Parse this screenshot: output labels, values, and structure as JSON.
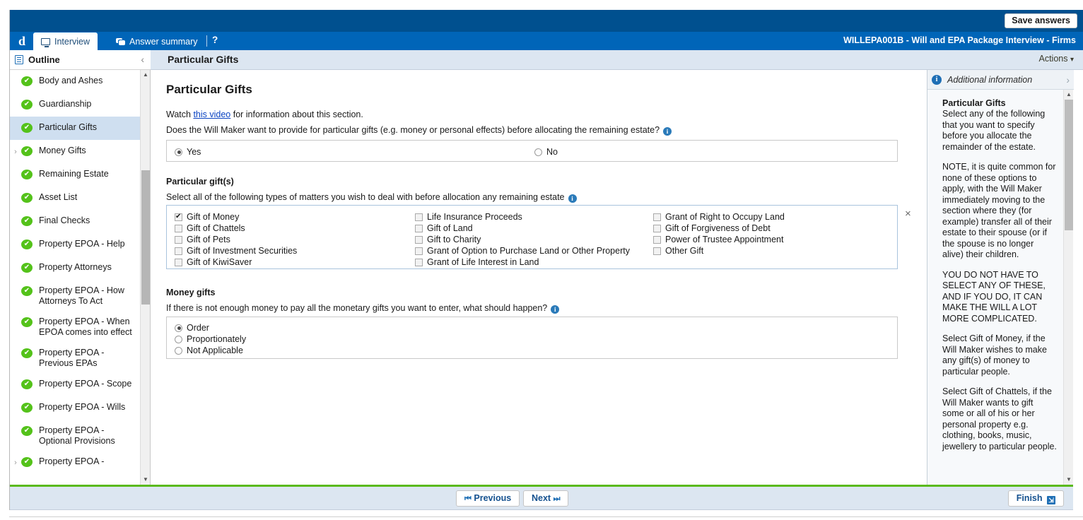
{
  "window": {
    "save_answers_label": "Save answers",
    "document_title": "WILLEPA001B - Will and EPA Package Interview - Firms",
    "logo_text": "d"
  },
  "tabs": [
    {
      "label": "Interview",
      "icon": "monitor-icon",
      "active": true
    },
    {
      "label": "Answer summary",
      "icon": "chat-icon",
      "active": false
    }
  ],
  "help_label": "?",
  "outline": {
    "header_label": "Outline",
    "collapse_icon": "chevron-left-icon",
    "items": [
      {
        "label": "Body and Ashes",
        "status": "complete",
        "expandable": false,
        "selected": false
      },
      {
        "label": "Guardianship",
        "status": "complete",
        "expandable": false,
        "selected": false
      },
      {
        "label": "Particular Gifts",
        "status": "complete",
        "expandable": false,
        "selected": true
      },
      {
        "label": "Money Gifts",
        "status": "complete",
        "expandable": true,
        "selected": false
      },
      {
        "label": "Remaining Estate",
        "status": "complete",
        "expandable": false,
        "selected": false
      },
      {
        "label": "Asset List",
        "status": "complete",
        "expandable": false,
        "selected": false
      },
      {
        "label": "Final Checks",
        "status": "complete",
        "expandable": false,
        "selected": false
      },
      {
        "label": "Property EPOA - Help",
        "status": "complete",
        "expandable": false,
        "selected": false
      },
      {
        "label": "Property Attorneys",
        "status": "complete",
        "expandable": false,
        "selected": false
      },
      {
        "label": "Property EPOA - How Attorneys To Act",
        "status": "complete",
        "expandable": false,
        "selected": false
      },
      {
        "label": "Property EPOA - When EPOA comes into effect",
        "status": "complete",
        "expandable": false,
        "selected": false
      },
      {
        "label": "Property EPOA - Previous EPAs",
        "status": "complete",
        "expandable": false,
        "selected": false
      },
      {
        "label": "Property EPOA - Scope",
        "status": "complete",
        "expandable": false,
        "selected": false
      },
      {
        "label": "Property EPOA - Wills",
        "status": "complete",
        "expandable": false,
        "selected": false
      },
      {
        "label": "Property EPOA - Optional Provisions",
        "status": "complete",
        "expandable": false,
        "selected": false
      },
      {
        "label": "Property EPOA -",
        "status": "complete",
        "expandable": true,
        "selected": false
      }
    ]
  },
  "page_header": {
    "title": "Particular Gifts",
    "actions_label": "Actions",
    "actions_caret": "▾"
  },
  "main": {
    "title": "Particular Gifts",
    "watch_prefix": "Watch ",
    "watch_link": "this video",
    "watch_suffix": " for information about this section.",
    "question_1": "Does the Will Maker want to provide for particular gifts (e.g. money or personal effects) before allocating the remaining estate?",
    "yes_no": [
      {
        "label": "Yes",
        "selected": true
      },
      {
        "label": "No",
        "selected": false
      }
    ],
    "gifts_section_label": "Particular gift(s)",
    "gifts_question": "Select all of the following types of matters you wish to deal with before allocation any remaining estate",
    "gifts_close_icon": "×",
    "gifts_columns": [
      [
        {
          "label": "Gift of Money",
          "checked": true
        },
        {
          "label": "Gift of Chattels",
          "checked": false
        },
        {
          "label": "Gift of Pets",
          "checked": false
        },
        {
          "label": "Gift of Investment Securities",
          "checked": false
        },
        {
          "label": "Gift of KiwiSaver",
          "checked": false
        }
      ],
      [
        {
          "label": "Life Insurance Proceeds",
          "checked": false
        },
        {
          "label": "Gift of Land",
          "checked": false
        },
        {
          "label": "Gift to Charity",
          "checked": false
        },
        {
          "label": "Grant of Option to Purchase Land or Other Property",
          "checked": false
        },
        {
          "label": "Grant of Life Interest in Land",
          "checked": false
        }
      ],
      [
        {
          "label": "Grant of Right to Occupy Land",
          "checked": false
        },
        {
          "label": "Gift of Forgiveness of Debt",
          "checked": false
        },
        {
          "label": "Power of Trustee Appointment",
          "checked": false
        },
        {
          "label": "Other Gift",
          "checked": false
        }
      ]
    ],
    "money_section_label": "Money gifts",
    "money_question": "If there is not enough money to pay all the monetary gifts you want to enter, what should happen?",
    "money_options": [
      {
        "label": "Order",
        "selected": true
      },
      {
        "label": "Proportionately",
        "selected": false
      },
      {
        "label": "Not Applicable",
        "selected": false
      }
    ],
    "info_icon_glyph": "i"
  },
  "info_panel": {
    "header_label": "Additional information",
    "header_icon": "info-icon",
    "expand_icon": "chevron-right-icon",
    "heading": "Particular Gifts",
    "paragraphs": [
      "Select any of the following that you want to specify before you allocate the remainder of the estate.",
      "NOTE, it is quite common for none of these options to apply, with the Will Maker immediately moving to the section where they (for example) transfer all of their estate to their spouse (or if the spouse is no longer alive) their children.",
      "YOU DO NOT HAVE TO SELECT ANY OF THESE, AND IF YOU DO, IT CAN MAKE THE WILL A LOT MORE COMPLICATED.",
      "Select Gift of Money, if the Will Maker wishes to make any gift(s) of money to particular people.",
      "Select Gift of Chattels, if the Will Maker wants to gift some or all of his or her personal property e.g. clothing, books, music, jewellery to particular people."
    ]
  },
  "footer": {
    "previous_label": "Previous",
    "previous_icon": "⏮",
    "next_label": "Next",
    "next_icon": "⏭",
    "finish_label": "Finish",
    "finish_icon": "finish-icon"
  },
  "colors": {
    "header_dark_blue": "#00508f",
    "tabbar_blue": "#0065b8",
    "subheader_blue": "#dce6f1",
    "green_accent": "#5bba1e",
    "selected_row": "#cfdff0",
    "link_blue": "#0a43c2"
  }
}
